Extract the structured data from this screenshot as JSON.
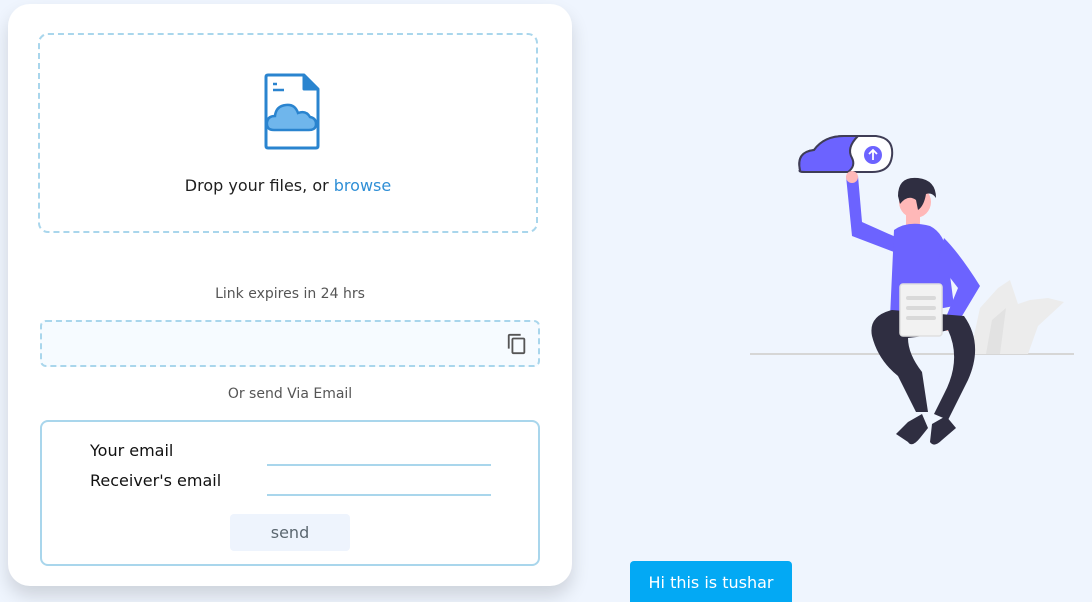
{
  "upload": {
    "drop_text": "Drop your files, or ",
    "browse_label": "browse",
    "icon": "cloud-file-icon"
  },
  "share": {
    "expires_text": "Link expires in 24 hrs",
    "link_value": "",
    "copy_icon": "copy-icon",
    "or_email_text": "Or send Via Email"
  },
  "email_form": {
    "your_email_label": "Your email",
    "your_email_value": "",
    "receiver_email_label": "Receiver's email",
    "receiver_email_value": "",
    "send_label": "send"
  },
  "toast": {
    "message": "Hi this is tushar"
  },
  "colors": {
    "accent": "#2f8fd6",
    "dashed_border": "#a9d6ec",
    "page_background": "#eff5fe",
    "toast_background": "#03a9f4",
    "illustration_purple": "#6c63ff"
  }
}
